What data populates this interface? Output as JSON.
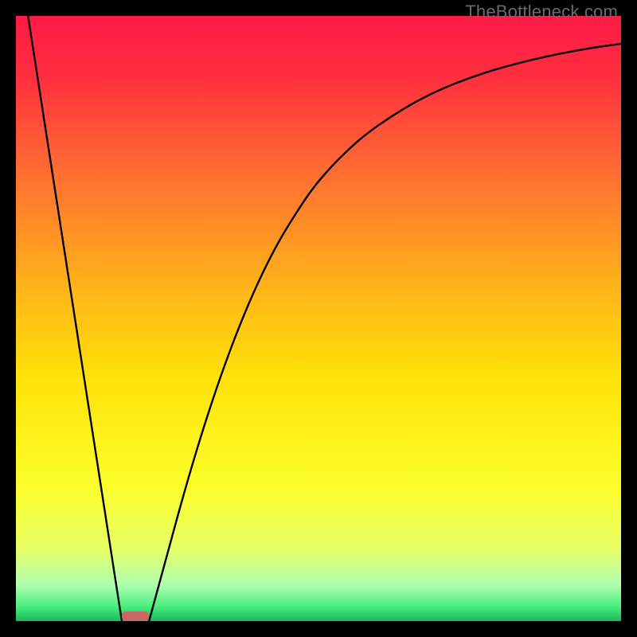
{
  "watermark": "TheBottleneck.com",
  "chart_data": {
    "type": "line",
    "title": "",
    "xlabel": "",
    "ylabel": "",
    "xlim": [
      0,
      100
    ],
    "ylim": [
      0,
      100
    ],
    "grid": false,
    "background_gradient": {
      "stops": [
        {
          "pos": 0.0,
          "color": "#ff1a44"
        },
        {
          "pos": 0.1,
          "color": "#ff2f3f"
        },
        {
          "pos": 0.25,
          "color": "#ff6a33"
        },
        {
          "pos": 0.45,
          "color": "#ffb419"
        },
        {
          "pos": 0.6,
          "color": "#ffe209"
        },
        {
          "pos": 0.78,
          "color": "#fcff2a"
        },
        {
          "pos": 0.88,
          "color": "#e7ff67"
        },
        {
          "pos": 0.94,
          "color": "#afffb0"
        },
        {
          "pos": 0.975,
          "color": "#4cf07f"
        },
        {
          "pos": 1.0,
          "color": "#18b85e"
        }
      ]
    },
    "series": [
      {
        "name": "left-descent",
        "type": "line",
        "x": [
          2.0,
          17.5
        ],
        "y": [
          100.0,
          0.0
        ]
      },
      {
        "name": "right-curve",
        "type": "line",
        "x": [
          22.0,
          25,
          28,
          31,
          34,
          37,
          40,
          43,
          46,
          49,
          52,
          55,
          58,
          62,
          66,
          70,
          75,
          80,
          85,
          90,
          95,
          100
        ],
        "y": [
          0.0,
          11,
          22,
          32,
          41,
          49,
          56,
          62,
          67,
          71.5,
          75,
          78,
          80.6,
          83.4,
          85.8,
          87.8,
          89.8,
          91.4,
          92.7,
          93.8,
          94.7,
          95.4
        ]
      }
    ],
    "marker": {
      "name": "bottleneck-marker",
      "x_start": 17.5,
      "x_end": 22.0,
      "y": 0,
      "color": "#cc6666"
    }
  }
}
